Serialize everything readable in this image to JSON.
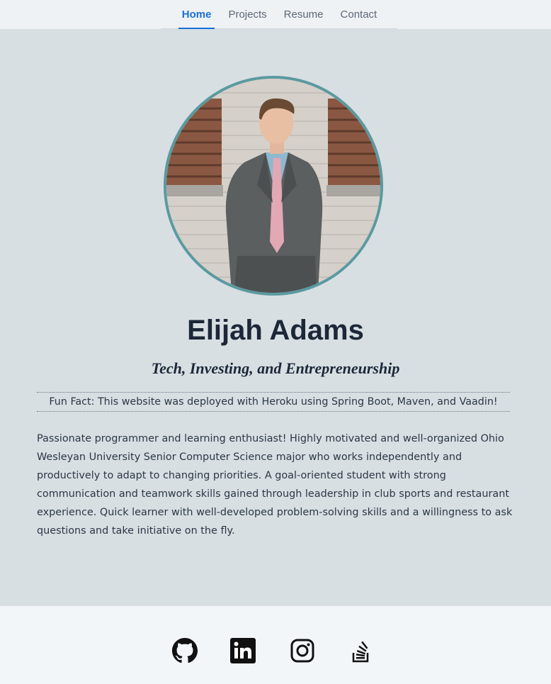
{
  "nav": {
    "tabs": [
      {
        "label": "Home",
        "active": true
      },
      {
        "label": "Projects",
        "active": false
      },
      {
        "label": "Resume",
        "active": false
      },
      {
        "label": "Contact",
        "active": false
      }
    ]
  },
  "profile": {
    "name": "Elijah Adams",
    "tagline": "Tech, Investing, and Entrepreneurship",
    "fun_fact": "Fun Fact: This website was deployed with Heroku using Spring Boot, Maven, and Vaadin!",
    "bio": "Passionate programmer and learning enthusiast! Highly motivated and well-organized Ohio Wesleyan University Senior Computer Science major who works independently and productively to adapt to changing priorities. A goal-oriented student with strong communication and teamwork skills gained through leadership in club sports and restaurant experience. Quick learner with well-developed problem-solving skills and a willingness to ask questions and take initiative on the fly."
  },
  "footer": {
    "icons": [
      "github-icon",
      "linkedin-icon",
      "instagram-icon",
      "stackoverflow-icon"
    ]
  },
  "colors": {
    "accent": "#1a6fd6",
    "avatar_border": "#5a9aa0",
    "page_bg": "#d7dfe3",
    "footer_bg": "#f3f6f9"
  }
}
